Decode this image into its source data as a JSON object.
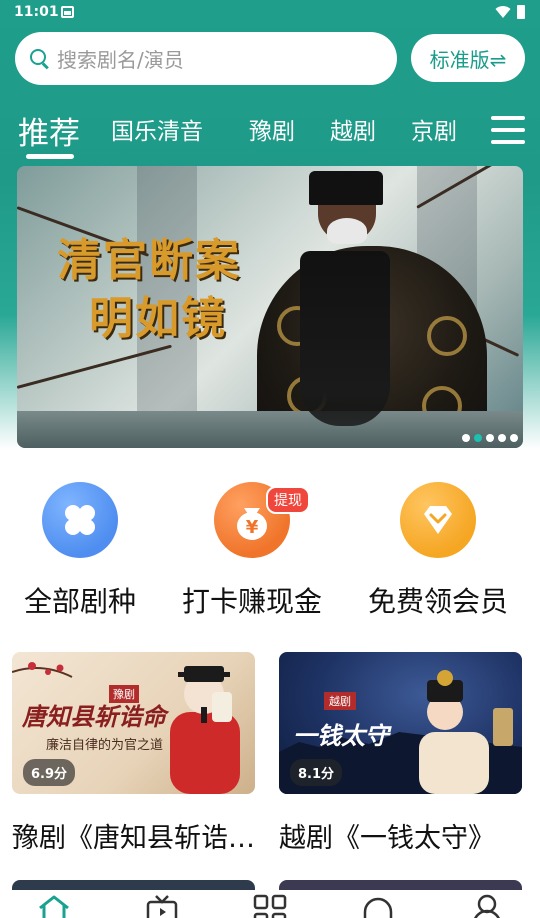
{
  "status_bar": {
    "time": "11:01"
  },
  "search": {
    "placeholder": "搜索剧名/演员"
  },
  "version_button": {
    "label": "标准版⇌"
  },
  "tabs": [
    {
      "label": "推荐",
      "active": true
    },
    {
      "label": "国乐清音",
      "active": false
    },
    {
      "label": "豫剧",
      "active": false
    },
    {
      "label": "越剧",
      "active": false
    },
    {
      "label": "京剧",
      "active": false
    }
  ],
  "banner": {
    "title_line1": "清官断案",
    "title_line2": "明如镜",
    "page_count": 5,
    "active_page": 2
  },
  "quick_actions": [
    {
      "label": "全部剧种",
      "icon": "clover-icon",
      "color": "#4f8ef0"
    },
    {
      "label": "打卡赚现金",
      "icon": "money-bag-icon",
      "color": "#f0742a",
      "badge": "提现"
    },
    {
      "label": "免费领会员",
      "icon": "vip-diamond-icon",
      "color": "#f5a623"
    }
  ],
  "cards": [
    {
      "thumb_title": "唐知县斩诰命",
      "thumb_tag": "豫剧",
      "thumb_subtitle": "廉洁自律的为官之道",
      "score": "6.9分",
      "title": "豫剧《唐知县斩诰命》"
    },
    {
      "thumb_title": "一钱太守",
      "thumb_tag": "越剧",
      "score": "8.1分",
      "title": "越剧《一钱太守》"
    }
  ],
  "bottom_nav": [
    {
      "icon": "home-icon",
      "active": true
    },
    {
      "icon": "tv-icon",
      "active": false
    },
    {
      "icon": "grid-icon",
      "active": false
    },
    {
      "icon": "headphones-icon",
      "active": false
    },
    {
      "icon": "person-icon",
      "active": false
    }
  ],
  "colors": {
    "brand": "#1f9e8c",
    "accent": "#1aa291"
  }
}
